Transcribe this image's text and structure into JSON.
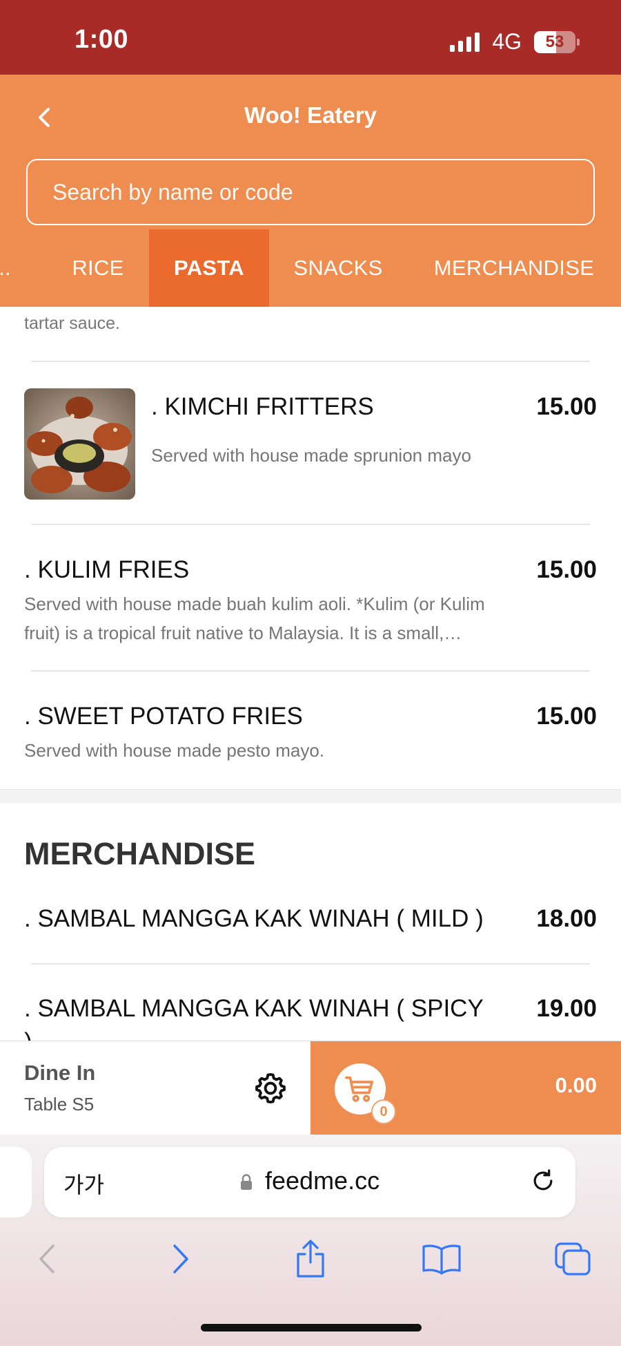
{
  "status_bar": {
    "time": "1:00",
    "network": "4G",
    "battery": "53",
    "battery_level": 0.53
  },
  "header": {
    "title": "Woo! Eatery",
    "back_icon": "chevron-left-icon"
  },
  "search": {
    "placeholder": "Search by name or code"
  },
  "categories": {
    "items": [
      {
        "label": ".."
      },
      {
        "label": "RICE"
      },
      {
        "label": "PASTA",
        "active": true
      },
      {
        "label": "SNACKS"
      },
      {
        "label": "MERCHANDISE"
      }
    ]
  },
  "menu": {
    "tail_text": "tartar sauce.",
    "snacks": [
      {
        "name": ". KIMCHI FRITTERS",
        "price": "15.00",
        "description": "Served with house made sprunion mayo",
        "has_image": true
      },
      {
        "name": ". KULIM FRIES",
        "price": "15.00",
        "description_line1": "Served with house made buah kulim aoli. *Kulim (or Kulim",
        "description_line2": "fruit) is a tropical fruit native to Malaysia. It is a small,…"
      },
      {
        "name": ". SWEET POTATO FRIES",
        "price": "15.00",
        "description": "Served with house made pesto mayo."
      }
    ],
    "merchandise_title": "MERCHANDISE",
    "merchandise": [
      {
        "name": ". SAMBAL MANGGA KAK WINAH ( MILD )",
        "price": "18.00"
      },
      {
        "name": ". SAMBAL MANGGA KAK WINAH ( SPICY",
        "name_wrap": ")",
        "price": "19.00"
      }
    ]
  },
  "bottom_bar": {
    "order_type": "Dine In",
    "table": "Table S5",
    "settings_icon": "gear-icon",
    "cart_icon": "cart-icon",
    "cart_count": "0",
    "cart_total": "0.00"
  },
  "browser": {
    "aa_label": "가가",
    "url": "feedme.cc",
    "icons": [
      "lock-icon",
      "reload-icon",
      "back-arrow-icon",
      "forward-arrow-icon",
      "share-icon",
      "bookmarks-icon",
      "tabs-icon"
    ]
  },
  "colors": {
    "status_bar": "#a92b27",
    "header": "#ef8d51",
    "active_tab": "#ea6a2e",
    "ios_blue": "#3478f6"
  }
}
